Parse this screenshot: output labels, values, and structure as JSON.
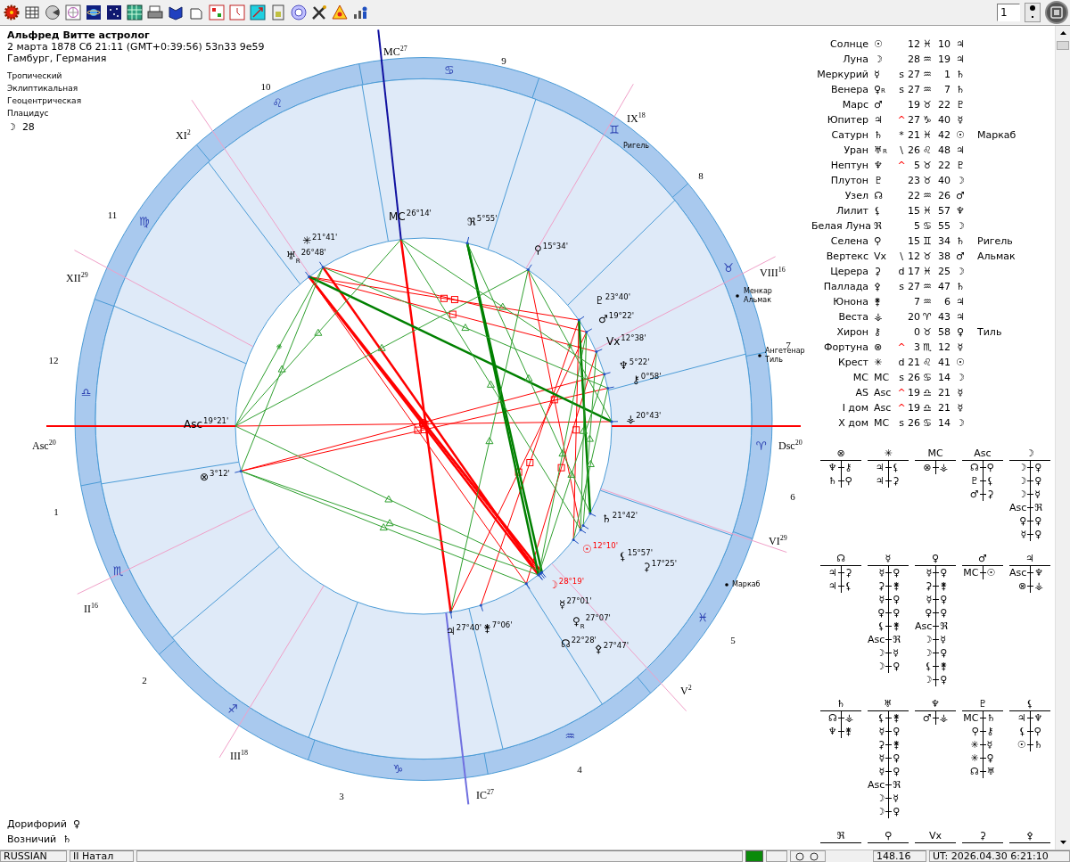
{
  "toolbar": {
    "counter": "1"
  },
  "header": {
    "title": "Альфред Витте астролог",
    "date": "2 марта 1878  Сб  21:11 (GMT+0:39:56) 53n33  9e59",
    "place": "Гамбург, Германия",
    "settings": [
      "Тропический",
      "Эклиптикальная",
      "Геоцентрическая",
      "Плацидус"
    ],
    "moon_day": {
      "glyph": "☽",
      "value": "28"
    }
  },
  "fixed_stars": [
    {
      "name": "Дорифорий",
      "glyph": "♀"
    },
    {
      "name": "Возничий",
      "glyph": "♄"
    }
  ],
  "chart": {
    "signs": [
      "♈",
      "♉",
      "♊",
      "♋",
      "♌",
      "♍",
      "♎",
      "♏",
      "♐",
      "♑",
      "♒",
      "♓"
    ],
    "house_numbers": [
      "1",
      "2",
      "3",
      "4",
      "5",
      "6",
      "7",
      "8",
      "9",
      "10",
      "11",
      "12"
    ],
    "cusp_labels": [
      {
        "label": "MC",
        "degree": "27"
      },
      {
        "label": "XI",
        "degree": "2"
      },
      {
        "label": "IX",
        "degree": "18"
      },
      {
        "label": "XII",
        "degree": "29"
      },
      {
        "label": "VIII",
        "degree": "16"
      },
      {
        "label": "Asc",
        "degree": "20"
      },
      {
        "label": "Dsc",
        "degree": "20"
      },
      {
        "label": "VI",
        "degree": "29"
      },
      {
        "label": "II",
        "degree": "16"
      },
      {
        "label": "V",
        "degree": "2"
      },
      {
        "label": "III",
        "degree": "18"
      },
      {
        "label": "IC",
        "degree": "27"
      }
    ],
    "planets": [
      {
        "glyph": "✳",
        "degree": "21°41'",
        "highlighted": false
      },
      {
        "glyph": "♅",
        "retro": "R",
        "degree": "26°48'",
        "highlighted": false
      },
      {
        "glyph": "MC",
        "degree": "26°14'",
        "highlighted": false
      },
      {
        "glyph": "ℜ",
        "degree": "5°55'",
        "highlighted": false
      },
      {
        "glyph": "⚲",
        "degree": "15°34'",
        "highlighted": false
      },
      {
        "glyph": "♇",
        "degree": "23°40'",
        "highlighted": false
      },
      {
        "glyph": "♂",
        "degree": "19°22'",
        "highlighted": false
      },
      {
        "glyph": "Vx",
        "degree": "12°38'",
        "highlighted": false
      },
      {
        "glyph": "♆",
        "degree": "5°22'",
        "highlighted": false
      },
      {
        "glyph": "⚷",
        "degree": "0°58'",
        "highlighted": false
      },
      {
        "glyph": "⚶",
        "degree": "20°43'",
        "highlighted": false
      },
      {
        "glyph": "♄",
        "degree": "21°42'",
        "highlighted": false
      },
      {
        "glyph": "☉",
        "degree": "12°10'",
        "highlighted": true
      },
      {
        "glyph": "⚸",
        "degree": "15°57'",
        "highlighted": false
      },
      {
        "glyph": "⚳",
        "degree": "17°25'",
        "highlighted": false
      },
      {
        "glyph": "☽",
        "degree": "28°19'",
        "highlighted": true
      },
      {
        "glyph": "☿",
        "degree": "27°01'",
        "highlighted": false
      },
      {
        "glyph": "♀",
        "retro": "R",
        "degree": "27°07'",
        "highlighted": false
      },
      {
        "glyph": "☊",
        "degree": "22°28'",
        "highlighted": false
      },
      {
        "glyph": "⚴",
        "degree": "27°47'",
        "highlighted": false
      },
      {
        "glyph": "♃",
        "degree": "27°40'",
        "highlighted": false
      },
      {
        "glyph": "⚵",
        "degree": "7°06'",
        "highlighted": false
      },
      {
        "glyph": "Asc",
        "degree": "19°21'",
        "highlighted": false
      },
      {
        "glyph": "⊗",
        "degree": "3°12'",
        "highlighted": false
      }
    ],
    "stars": [
      "Ригель",
      "Менкар",
      "Альмак",
      "Ангетенар",
      "Тиль",
      "Маркаб"
    ]
  },
  "positions": [
    {
      "name": "Солнце",
      "glyph": "☉",
      "deg": "12",
      "sign": "♓",
      "min": "10",
      "ruler": "♃"
    },
    {
      "name": "Луна",
      "glyph": "☽",
      "deg": "28",
      "sign": "♒",
      "min": "19",
      "ruler": "♃"
    },
    {
      "name": "Меркурий",
      "glyph": "☿",
      "mark": "s",
      "mark_highlighted": false,
      "deg": "27",
      "sign": "♒",
      "min": "1",
      "ruler": "♄"
    },
    {
      "name": "Венера",
      "glyph": "♀",
      "retro": "R",
      "mark": "s",
      "mark_highlighted": false,
      "deg": "27",
      "sign": "♒",
      "min": "7",
      "ruler": "♄"
    },
    {
      "name": "Марс",
      "glyph": "♂",
      "deg": "19",
      "sign": "♉",
      "min": "22",
      "ruler": "♇"
    },
    {
      "name": "Юпитер",
      "glyph": "♃",
      "mark": "^",
      "mark_highlighted": true,
      "deg": "27",
      "sign": "♑",
      "min": "40",
      "ruler": "☿"
    },
    {
      "name": "Сатурн",
      "glyph": "♄",
      "mark": "*",
      "mark_highlighted": false,
      "deg": "21",
      "sign": "♓",
      "min": "42",
      "ruler": "☉",
      "star": "Маркаб"
    },
    {
      "name": "Уран",
      "glyph": "♅",
      "retro": "R",
      "mark": "\\",
      "mark_highlighted": false,
      "deg": "26",
      "sign": "♌",
      "min": "48",
      "ruler": "♃"
    },
    {
      "name": "Нептун",
      "glyph": "♆",
      "mark": "^",
      "mark_highlighted": true,
      "deg": "5",
      "sign": "♉",
      "min": "22",
      "ruler": "♇"
    },
    {
      "name": "Плутон",
      "glyph": "♇",
      "deg": "23",
      "sign": "♉",
      "min": "40",
      "ruler": "☽"
    },
    {
      "name": "Узел",
      "glyph": "☊",
      "deg": "22",
      "sign": "♒",
      "min": "26",
      "ruler": "♂"
    },
    {
      "name": "Лилит",
      "glyph": "⚸",
      "deg": "15",
      "sign": "♓",
      "min": "57",
      "ruler": "♆"
    },
    {
      "name": "Белая Луна",
      "glyph": "ℜ",
      "deg": "5",
      "sign": "♋",
      "min": "55",
      "ruler": "☽"
    },
    {
      "name": "Селена",
      "glyph": "⚲",
      "deg": "15",
      "sign": "♊",
      "min": "34",
      "ruler": "♄",
      "star": "Ригель"
    },
    {
      "name": "Вертекс",
      "glyph": "Vx",
      "mark": "\\",
      "mark_highlighted": false,
      "deg": "12",
      "sign": "♉",
      "min": "38",
      "ruler": "♂",
      "star": "Альмак"
    },
    {
      "name": "Церера",
      "glyph": "⚳",
      "mark": "d",
      "mark_highlighted": false,
      "deg": "17",
      "sign": "♓",
      "min": "25",
      "ruler": "☽"
    },
    {
      "name": "Паллада",
      "glyph": "⚴",
      "mark": "s",
      "mark_highlighted": false,
      "deg": "27",
      "sign": "♒",
      "min": "47",
      "ruler": "♄"
    },
    {
      "name": "Юнона",
      "glyph": "⚵",
      "deg": "7",
      "sign": "♒",
      "min": "6",
      "ruler": "♃"
    },
    {
      "name": "Веста",
      "glyph": "⚶",
      "deg": "20",
      "sign": "♈",
      "min": "43",
      "ruler": "♃"
    },
    {
      "name": "Хирон",
      "glyph": "⚷",
      "deg": "0",
      "sign": "♉",
      "min": "58",
      "ruler": "♀",
      "star": "Тиль"
    },
    {
      "name": "Фортуна",
      "glyph": "⊗",
      "mark": "^",
      "mark_highlighted": true,
      "deg": "3",
      "sign": "♏",
      "min": "12",
      "ruler": "☿"
    },
    {
      "name": "Крест",
      "glyph": "✳",
      "mark": "d",
      "mark_highlighted": false,
      "deg": "21",
      "sign": "♌",
      "min": "41",
      "ruler": "☉"
    },
    {
      "name": "MC",
      "glyph": "MC",
      "mark": "s",
      "mark_highlighted": false,
      "deg": "26",
      "sign": "♋",
      "min": "14",
      "ruler": "☽"
    },
    {
      "name": "AS",
      "glyph": "Asc",
      "mark": "^",
      "mark_highlighted": true,
      "deg": "19",
      "sign": "♎",
      "min": "21",
      "ruler": "☿"
    },
    {
      "name": "I дом",
      "glyph": "Asc",
      "mark": "^",
      "mark_highlighted": true,
      "deg": "19",
      "sign": "♎",
      "min": "21",
      "ruler": "☿"
    },
    {
      "name": "X дом",
      "glyph": "MC",
      "mark": "s",
      "mark_highlighted": false,
      "deg": "26",
      "sign": "♋",
      "min": "14",
      "ruler": "☽"
    }
  ],
  "dispositor_groups": [
    [
      {
        "head": "⊗",
        "rows": [
          [
            "♆",
            "⚷"
          ],
          [
            "♄",
            "⚲"
          ]
        ]
      },
      {
        "head": "✳",
        "rows": [
          [
            "♃",
            "⚸"
          ],
          [
            "♃",
            "⚳"
          ]
        ]
      },
      {
        "head": "MC",
        "rows": [
          [
            "⊗",
            "⚶"
          ]
        ]
      },
      {
        "head": "Asc",
        "rows": [
          [
            "☊",
            "⚲"
          ],
          [
            "♇",
            "⚸"
          ],
          [
            "♂",
            "⚳"
          ]
        ]
      },
      {
        "head": "☽",
        "rows": [
          [
            "☽",
            "♀"
          ],
          [
            "☽",
            "♀"
          ],
          [
            "☽",
            "☿"
          ],
          [
            "Asc",
            "ℜ"
          ],
          [
            "♀",
            "♀"
          ],
          [
            "☿",
            "♀"
          ]
        ]
      }
    ],
    [
      {
        "head": "☊",
        "rows": [
          [
            "♃",
            "⚳"
          ],
          [
            "♃",
            "⚸"
          ]
        ]
      },
      {
        "head": "☿",
        "rows": [
          [
            "☿",
            "♀"
          ],
          [
            "⚳",
            "⚵"
          ],
          [
            "☿",
            "♀"
          ],
          [
            "♀",
            "♀"
          ],
          [
            "⚸",
            "⚵"
          ],
          [
            "Asc",
            "ℜ"
          ],
          [
            "☽",
            "☿"
          ],
          [
            "☽",
            "♀"
          ]
        ]
      },
      {
        "head": "♀",
        "rows": [
          [
            "☿",
            "♀"
          ],
          [
            "⚳",
            "⚵"
          ],
          [
            "☿",
            "♀"
          ],
          [
            "♀",
            "♀"
          ],
          [
            "Asc",
            "ℜ"
          ],
          [
            "☽",
            "☿"
          ],
          [
            "☽",
            "♀"
          ],
          [
            "⚸",
            "⚵"
          ],
          [
            "☽",
            "♀"
          ]
        ]
      },
      {
        "head": "♂",
        "rows": [
          [
            "MC",
            "☉"
          ]
        ]
      },
      {
        "head": "♃",
        "rows": [
          [
            "Asc",
            "♆"
          ],
          [
            "⊗",
            "⚶"
          ]
        ]
      }
    ],
    [
      {
        "head": "♄",
        "rows": [
          [
            "☊",
            "⚶"
          ],
          [
            "♆",
            "⚵"
          ]
        ]
      },
      {
        "head": "♅",
        "rows": [
          [
            "⚸",
            "⚵"
          ],
          [
            "☿",
            "♀"
          ],
          [
            "⚳",
            "⚵"
          ],
          [
            "☿",
            "♀"
          ],
          [
            "☿",
            "♀"
          ],
          [
            "Asc",
            "ℜ"
          ],
          [
            "☽",
            "☿"
          ],
          [
            "☽",
            "♀"
          ]
        ]
      },
      {
        "head": "♆",
        "rows": [
          [
            "♂",
            "⚶"
          ]
        ]
      },
      {
        "head": "♇",
        "rows": [
          [
            "MC",
            "♄"
          ],
          [
            "⚲",
            "⚷"
          ],
          [
            "✳",
            "☿"
          ],
          [
            "✳",
            "♀"
          ],
          [
            "☊",
            "♅"
          ]
        ]
      },
      {
        "head": "⚸",
        "rows": [
          [
            "♃",
            "♆"
          ],
          [
            "⚸",
            "⚲"
          ],
          [
            "☉",
            "♄"
          ]
        ]
      }
    ],
    [
      {
        "head": "ℜ"
      },
      {
        "head": "⚲"
      },
      {
        "head": "Vx"
      },
      {
        "head": "⚳"
      },
      {
        "head": "⚴"
      }
    ]
  ],
  "status_bar": {
    "language": "RUSSIAN",
    "mode": "II Натал",
    "value": "148.16",
    "time": "UT: 2026.04.30  6:21:10"
  }
}
